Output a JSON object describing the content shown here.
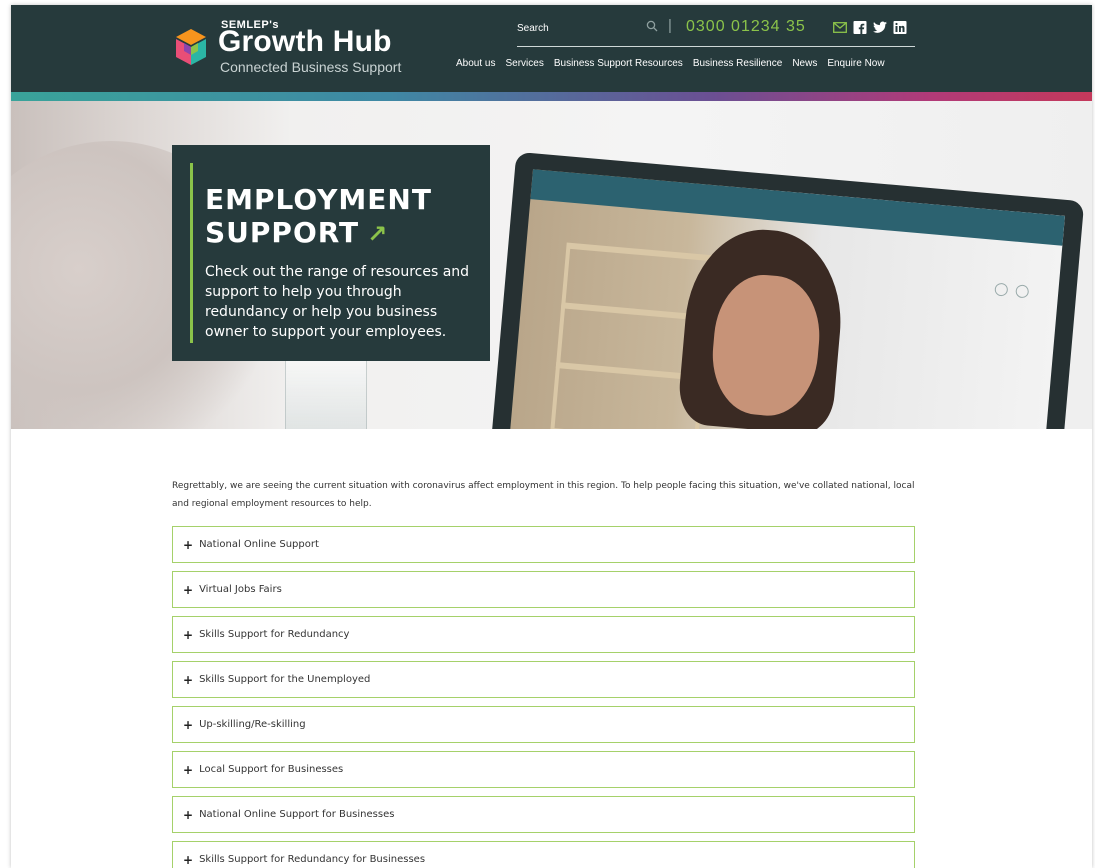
{
  "header": {
    "logo_prefix": "SEMLEP's",
    "logo_title": "Growth Hub",
    "logo_subtitle": "Connected Business Support",
    "search_label": "Search",
    "separator": "|",
    "phone": "0300 01234 35",
    "social_icons": [
      "email-icon",
      "facebook-icon",
      "twitter-icon",
      "linkedin-icon"
    ],
    "nav": [
      "About us",
      "Services",
      "Business Support Resources",
      "Business Resilience",
      "News",
      "Enquire Now"
    ]
  },
  "hero": {
    "title_line1": "EMPLOYMENT",
    "title_line2": "SUPPORT",
    "arrow": "↗",
    "description": "Check out the range of resources and support to help you through redundancy or help you business owner to support your employees."
  },
  "intro_text": "Regrettably, we are seeing the current situation with coronavirus affect employment in this region. To help people facing this situation, we've collated national, local and regional employment resources to help.",
  "accordion": {
    "icon": "+",
    "items": [
      "National Online Support",
      "Virtual Jobs Fairs",
      "Skills Support for Redundancy",
      "Skills Support for the Unemployed",
      "Up-skilling/Re-skilling",
      "Local Support for Businesses",
      "National Online Support for Businesses",
      "Skills Support for Redundancy for Businesses"
    ]
  },
  "colors": {
    "header_bg": "#263a3c",
    "accent_green": "#8bc34a",
    "accordion_border": "#a5d16a"
  }
}
